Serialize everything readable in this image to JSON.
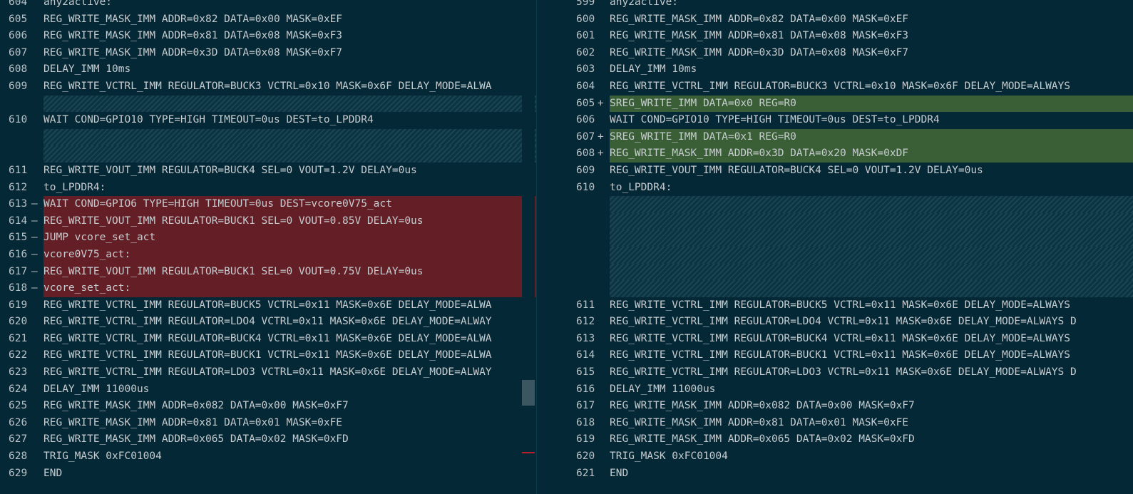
{
  "left": {
    "rows": [
      {
        "num": "604",
        "marker": "",
        "text": "any2active:",
        "type": "normal"
      },
      {
        "num": "605",
        "marker": "",
        "text": "REG_WRITE_MASK_IMM ADDR=0x82 DATA=0x00 MASK=0xEF",
        "type": "normal"
      },
      {
        "num": "606",
        "marker": "",
        "text": "REG_WRITE_MASK_IMM ADDR=0x81 DATA=0x08 MASK=0xF3",
        "type": "normal"
      },
      {
        "num": "607",
        "marker": "",
        "text": "REG_WRITE_MASK_IMM ADDR=0x3D DATA=0x08 MASK=0xF7",
        "type": "normal"
      },
      {
        "num": "608",
        "marker": "",
        "text": "DELAY_IMM 10ms",
        "type": "normal"
      },
      {
        "num": "609",
        "marker": "",
        "text": "REG_WRITE_VCTRL_IMM REGULATOR=BUCK3 VCTRL=0x10 MASK=0x6F DELAY_MODE=ALWA",
        "type": "normal"
      },
      {
        "num": "",
        "marker": "",
        "text": "",
        "type": "filler"
      },
      {
        "num": "610",
        "marker": "",
        "text": "WAIT COND=GPIO10 TYPE=HIGH TIMEOUT=0us DEST=to_LPDDR4",
        "type": "normal"
      },
      {
        "num": "",
        "marker": "",
        "text": "",
        "type": "filler"
      },
      {
        "num": "",
        "marker": "",
        "text": "",
        "type": "filler"
      },
      {
        "num": "611",
        "marker": "",
        "text": "REG_WRITE_VOUT_IMM REGULATOR=BUCK4 SEL=0 VOUT=1.2V DELAY=0us",
        "type": "normal"
      },
      {
        "num": "612",
        "marker": "",
        "text": "to_LPDDR4:",
        "type": "normal"
      },
      {
        "num": "613",
        "marker": "—",
        "text": "WAIT COND=GPIO6 TYPE=HIGH TIMEOUT=0us DEST=vcore0V75_act",
        "type": "removed"
      },
      {
        "num": "614",
        "marker": "—",
        "text": "REG_WRITE_VOUT_IMM REGULATOR=BUCK1 SEL=0 VOUT=0.85V DELAY=0us",
        "type": "removed"
      },
      {
        "num": "615",
        "marker": "—",
        "text": "JUMP vcore_set_act",
        "type": "removed"
      },
      {
        "num": "616",
        "marker": "—",
        "text": "vcore0V75_act:",
        "type": "removed"
      },
      {
        "num": "617",
        "marker": "—",
        "text": "REG_WRITE_VOUT_IMM REGULATOR=BUCK1 SEL=0 VOUT=0.75V DELAY=0us",
        "type": "removed"
      },
      {
        "num": "618",
        "marker": "—",
        "text": "vcore_set_act:",
        "type": "removed"
      },
      {
        "num": "619",
        "marker": "",
        "text": "REG_WRITE_VCTRL_IMM REGULATOR=BUCK5 VCTRL=0x11 MASK=0x6E DELAY_MODE=ALWA",
        "type": "normal"
      },
      {
        "num": "620",
        "marker": "",
        "text": "REG_WRITE_VCTRL_IMM REGULATOR=LDO4 VCTRL=0x11 MASK=0x6E DELAY_MODE=ALWAY",
        "type": "normal"
      },
      {
        "num": "621",
        "marker": "",
        "text": "REG_WRITE_VCTRL_IMM REGULATOR=BUCK4 VCTRL=0x11 MASK=0x6E DELAY_MODE=ALWA",
        "type": "normal"
      },
      {
        "num": "622",
        "marker": "",
        "text": "REG_WRITE_VCTRL_IMM REGULATOR=BUCK1 VCTRL=0x11 MASK=0x6E DELAY_MODE=ALWA",
        "type": "normal"
      },
      {
        "num": "623",
        "marker": "",
        "text": "REG_WRITE_VCTRL_IMM REGULATOR=LDO3 VCTRL=0x11 MASK=0x6E DELAY_MODE=ALWAY",
        "type": "normal"
      },
      {
        "num": "624",
        "marker": "",
        "text": "DELAY_IMM 11000us",
        "type": "normal"
      },
      {
        "num": "625",
        "marker": "",
        "text": "REG_WRITE_MASK_IMM ADDR=0x082 DATA=0x00 MASK=0xF7",
        "type": "normal"
      },
      {
        "num": "626",
        "marker": "",
        "text": "REG_WRITE_MASK_IMM ADDR=0x81 DATA=0x01 MASK=0xFE",
        "type": "normal"
      },
      {
        "num": "627",
        "marker": "",
        "text": "REG_WRITE_MASK_IMM ADDR=0x065 DATA=0x02 MASK=0xFD",
        "type": "normal"
      },
      {
        "num": "628",
        "marker": "",
        "text": "TRIG_MASK 0xFC01004",
        "type": "normal"
      },
      {
        "num": "629",
        "marker": "",
        "text": "END",
        "type": "normal"
      }
    ]
  },
  "right": {
    "rows": [
      {
        "num": "599",
        "marker": "",
        "text": "any2active:",
        "type": "normal"
      },
      {
        "num": "600",
        "marker": "",
        "text": "REG_WRITE_MASK_IMM ADDR=0x82 DATA=0x00 MASK=0xEF",
        "type": "normal"
      },
      {
        "num": "601",
        "marker": "",
        "text": "REG_WRITE_MASK_IMM ADDR=0x81 DATA=0x08 MASK=0xF3",
        "type": "normal"
      },
      {
        "num": "602",
        "marker": "",
        "text": "REG_WRITE_MASK_IMM ADDR=0x3D DATA=0x08 MASK=0xF7",
        "type": "normal"
      },
      {
        "num": "603",
        "marker": "",
        "text": "DELAY_IMM 10ms",
        "type": "normal"
      },
      {
        "num": "604",
        "marker": "",
        "text": "REG_WRITE_VCTRL_IMM REGULATOR=BUCK3 VCTRL=0x10 MASK=0x6F DELAY_MODE=ALWAYS",
        "type": "normal"
      },
      {
        "num": "605",
        "marker": "+",
        "text": "SREG_WRITE_IMM DATA=0x0 REG=R0",
        "type": "added"
      },
      {
        "num": "606",
        "marker": "",
        "text": "WAIT COND=GPIO10 TYPE=HIGH TIMEOUT=0us DEST=to_LPDDR4",
        "type": "normal"
      },
      {
        "num": "607",
        "marker": "+",
        "text": "SREG_WRITE_IMM DATA=0x1 REG=R0",
        "type": "added"
      },
      {
        "num": "608",
        "marker": "+",
        "text": "REG_WRITE_MASK_IMM ADDR=0x3D DATA=0x20 MASK=0xDF",
        "type": "added"
      },
      {
        "num": "609",
        "marker": "",
        "text": "REG_WRITE_VOUT_IMM REGULATOR=BUCK4 SEL=0 VOUT=1.2V DELAY=0us",
        "type": "normal"
      },
      {
        "num": "610",
        "marker": "",
        "text": "to_LPDDR4:",
        "type": "normal"
      },
      {
        "num": "",
        "marker": "",
        "text": "",
        "type": "filler"
      },
      {
        "num": "",
        "marker": "",
        "text": "",
        "type": "filler"
      },
      {
        "num": "",
        "marker": "",
        "text": "",
        "type": "filler"
      },
      {
        "num": "",
        "marker": "",
        "text": "",
        "type": "filler"
      },
      {
        "num": "",
        "marker": "",
        "text": "",
        "type": "filler"
      },
      {
        "num": "",
        "marker": "",
        "text": "",
        "type": "filler"
      },
      {
        "num": "611",
        "marker": "",
        "text": "REG_WRITE_VCTRL_IMM REGULATOR=BUCK5 VCTRL=0x11 MASK=0x6E DELAY_MODE=ALWAYS",
        "type": "normal"
      },
      {
        "num": "612",
        "marker": "",
        "text": "REG_WRITE_VCTRL_IMM REGULATOR=LDO4 VCTRL=0x11 MASK=0x6E DELAY_MODE=ALWAYS D",
        "type": "normal"
      },
      {
        "num": "613",
        "marker": "",
        "text": "REG_WRITE_VCTRL_IMM REGULATOR=BUCK4 VCTRL=0x11 MASK=0x6E DELAY_MODE=ALWAYS",
        "type": "normal"
      },
      {
        "num": "614",
        "marker": "",
        "text": "REG_WRITE_VCTRL_IMM REGULATOR=BUCK1 VCTRL=0x11 MASK=0x6E DELAY_MODE=ALWAYS",
        "type": "normal"
      },
      {
        "num": "615",
        "marker": "",
        "text": "REG_WRITE_VCTRL_IMM REGULATOR=LDO3 VCTRL=0x11 MASK=0x6E DELAY_MODE=ALWAYS D",
        "type": "normal"
      },
      {
        "num": "616",
        "marker": "",
        "text": "DELAY_IMM 11000us",
        "type": "normal"
      },
      {
        "num": "617",
        "marker": "",
        "text": "REG_WRITE_MASK_IMM ADDR=0x082 DATA=0x00 MASK=0xF7",
        "type": "normal"
      },
      {
        "num": "618",
        "marker": "",
        "text": "REG_WRITE_MASK_IMM ADDR=0x81 DATA=0x01 MASK=0xFE",
        "type": "normal"
      },
      {
        "num": "619",
        "marker": "",
        "text": "REG_WRITE_MASK_IMM ADDR=0x065 DATA=0x02 MASK=0xFD",
        "type": "normal"
      },
      {
        "num": "620",
        "marker": "",
        "text": "TRIG_MASK 0xFC01004",
        "type": "normal"
      },
      {
        "num": "621",
        "marker": "",
        "text": "END",
        "type": "normal"
      }
    ]
  },
  "colors": {
    "background": "#042835",
    "removed": "#631f25",
    "added": "#3a5f36",
    "scrollbar_thumb": "#3b5660",
    "scroll_marker": "#b3202c"
  }
}
